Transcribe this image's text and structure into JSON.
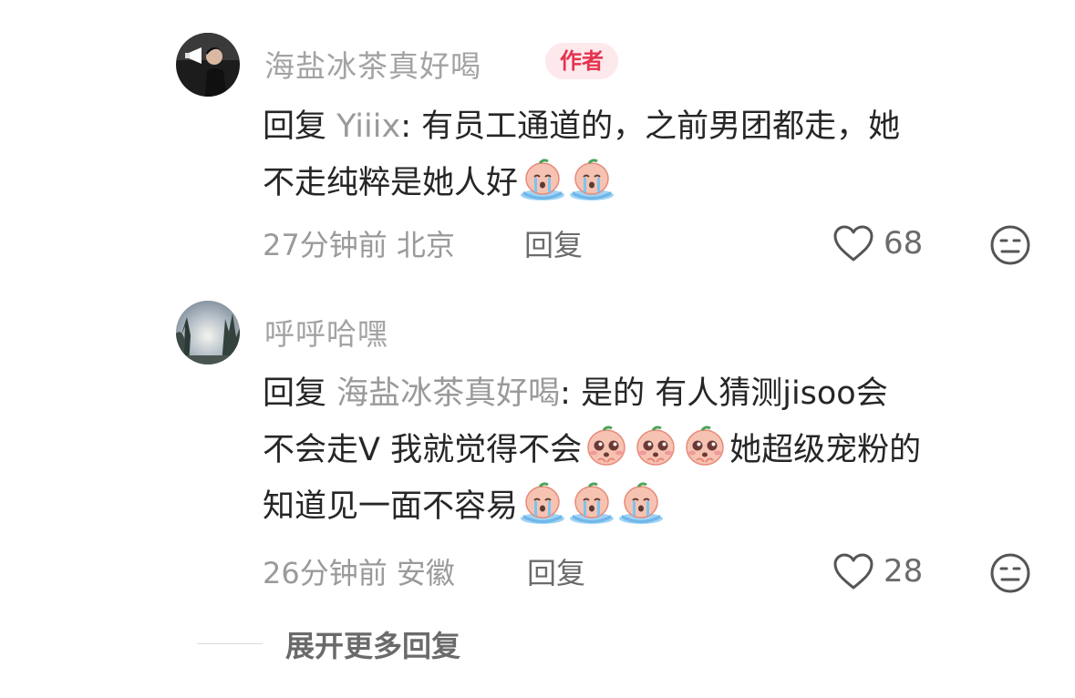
{
  "comments": [
    {
      "username": "海盐冰茶真好喝",
      "badge": "作者",
      "reply_prefix": "回复",
      "reply_to": "Yiiix",
      "text_line1": ": 有员工通道的，之前男团都走，她",
      "text_line2": "不走纯粹是她人好",
      "time": "27分钟前",
      "location": "北京",
      "reply_label": "回复",
      "likes": "68"
    },
    {
      "username": "呼呼哈嘿",
      "reply_prefix": "回复",
      "reply_to": "海盐冰茶真好喝",
      "text_line1": ": 是的 有人猜测jisoo会",
      "text_line2": "不会走V 我就觉得不会",
      "text_line2b": "她超级宠粉的",
      "text_line3": "知道见一面不容易",
      "time": "26分钟前",
      "location": "安徽",
      "reply_label": "回复",
      "likes": "28"
    }
  ],
  "expand_label": "展开更多回复",
  "colors": {
    "username": "#a3a3a3",
    "badge_bg": "#fde8ec",
    "badge_text": "#e5334f",
    "meta": "#9a9a9a"
  },
  "icons": [
    "heart-icon",
    "dislike-face-icon",
    "crying-peach-emoji",
    "pleading-peach-emoji"
  ]
}
